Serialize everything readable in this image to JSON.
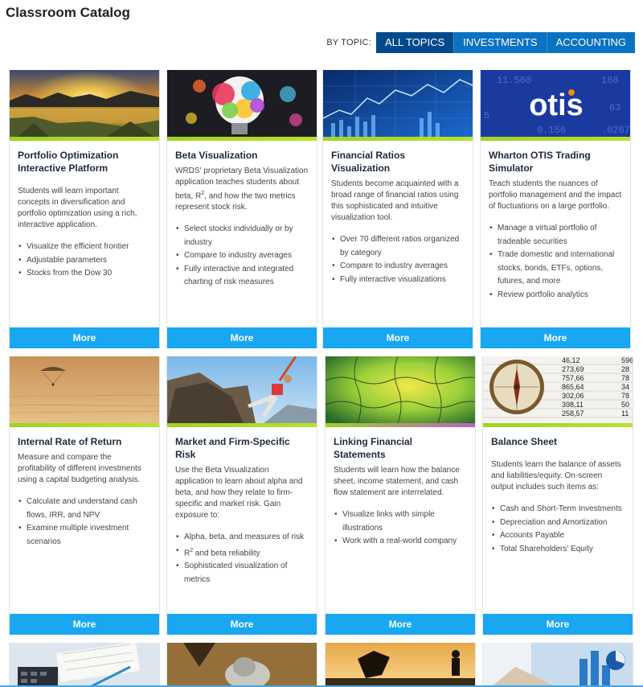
{
  "header": {
    "title": "Classroom Catalog"
  },
  "filter": {
    "label": "BY TOPIC:",
    "options": [
      "ALL TOPICS",
      "INVESTMENTS",
      "ACCOUNTING"
    ],
    "selected": "ALL TOPICS"
  },
  "colors": {
    "primary": "#0a72c1",
    "active": "#004a8c",
    "more": "#19a7f2",
    "accent": "#9ed324"
  },
  "cards": [
    {
      "image": "sunset-lake-image",
      "title": "Portfolio Optimization Interactive Platform",
      "desc": "Students will learn important concepts in diversification and portfolio optimization using a rich, interactive application.",
      "bullets": [
        "Visualize the efficient frontier",
        "Adjustable parameters",
        "Stocks from the Dow 30"
      ],
      "more": "More"
    },
    {
      "image": "colorful-lightbulb-image",
      "title": "Beta Visualization",
      "desc_parts": [
        "WRDS' proprietary Beta Visualization application teaches students about beta, R",
        "2",
        ", and how the two metrics represent stock risk."
      ],
      "bullets": [
        "Select stocks individually or by industry",
        "Compare to industry averages",
        "Fully interactive and integrated charting of risk measures"
      ],
      "more": "More"
    },
    {
      "image": "financial-chart-image",
      "title": "Financial Ratios Visualization",
      "desc": "Students become acquainted with a broad range of financial ratios using this sophisticated and intuitive visualization tool.",
      "bullets": [
        "Over 70 different ratios organized by category",
        "Compare to industry averages",
        "Fully interactive visualizations"
      ],
      "more": "More"
    },
    {
      "image": "otis-ticker-image",
      "image_text": "otis",
      "title": "Wharton OTIS Trading Simulator",
      "desc": "Teach students the nuances of portfolio management and the impact of fluctuations on a large portfolio.",
      "bullets": [
        "Manage a virtual portfolio of tradeable securities",
        "Trade domestic and international stocks, bonds, ETFs, options, futures, and more",
        "Review portfolio analytics"
      ],
      "more": "More"
    },
    {
      "image": "parachute-image",
      "title": "Internal Rate of Return",
      "desc": "Measure and compare the profitability of different investments using a capital budgeting analysis.",
      "bullets": [
        "Calculate and understand cash flows, IRR, and NPV",
        "Examine multiple investment scenarios"
      ],
      "more": "More"
    },
    {
      "image": "rock-climber-image",
      "title": "Market and Firm-Specific Risk",
      "desc": "Use the Beta Visualization application to learn about alpha and beta, and how they relate to firm-specific and market risk. Gain exposure to:",
      "bullets_parts": [
        [
          "Alpha, beta, and measures of risk"
        ],
        [
          "R",
          "2",
          " and beta reliability"
        ],
        [
          "Sophisticated visualization of metrics"
        ]
      ],
      "more": "More"
    },
    {
      "image": "puzzle-image",
      "title": "Linking Financial Statements",
      "desc": "Students will learn how the balance sheet, income statement, and cash flow statement are interrelated.",
      "bullets": [
        "Visualize links with simple illustrations",
        "Work with a real-world company"
      ],
      "more": "More"
    },
    {
      "image": "compass-ledger-image",
      "ledger": [
        "46,12",
        "273,69",
        "757,66",
        "865,64",
        "302,06",
        "398,11",
        "258,57"
      ],
      "ledger_right": [
        "596",
        "28",
        "78",
        "34",
        "78",
        "50",
        "11"
      ],
      "title": "Balance Sheet",
      "desc": "Students learn the balance of assets and liabilities/equity. On-screen output includes such items as:",
      "bullets": [
        "Cash and Short-Term Investments",
        "Depreciation and Amortization",
        "Accounts Payable",
        "Total Shareholders' Equity"
      ],
      "more": "More"
    }
  ],
  "bottom_row": [
    "calculator-image",
    "coins-image",
    "silhouette-image",
    "laptop-chart-image"
  ]
}
